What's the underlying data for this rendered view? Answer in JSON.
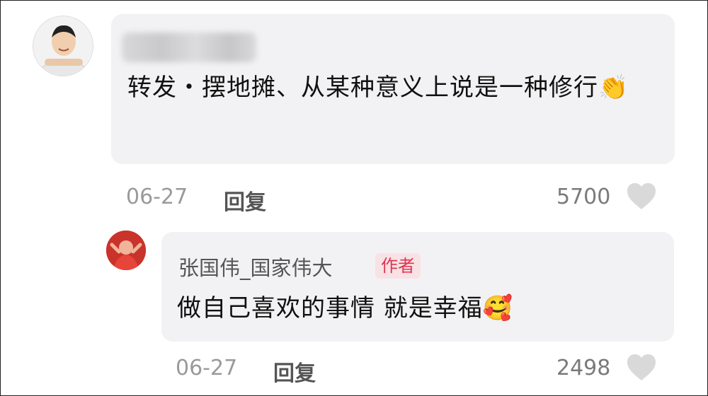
{
  "comment": {
    "username": "",
    "text": "转发・摆地摊、从某种意义上说是一种修行",
    "emoji": "👏",
    "date": "06-27",
    "reply_label": "回复",
    "likes": "5700"
  },
  "reply": {
    "username": "张国伟_国家伟大",
    "badge": "作者",
    "text": "做自己喜欢的事情 就是幸福",
    "emoji": "🥰",
    "date": "06-27",
    "reply_label": "回复",
    "likes": "2498"
  },
  "icons": {
    "like": "heart-icon"
  },
  "colors": {
    "bubble_bg": "#f2f2f4",
    "badge_bg": "#f8e2e5",
    "badge_text": "#e0344f",
    "heart": "#d9d9d9"
  }
}
